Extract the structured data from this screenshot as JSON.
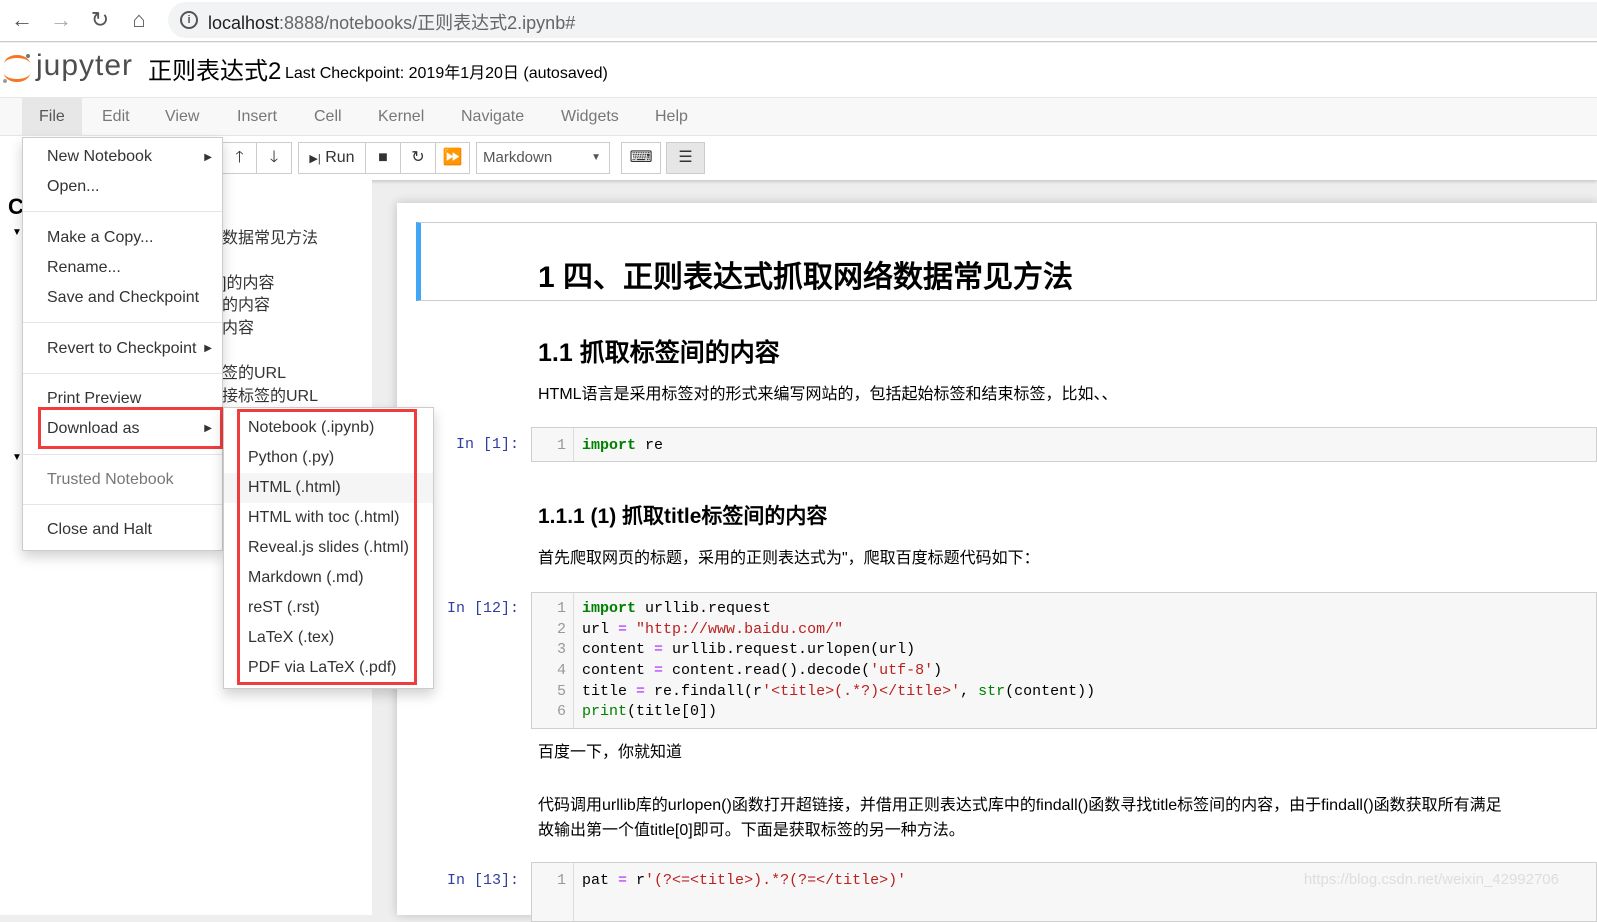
{
  "browser": {
    "url_host": "localhost",
    "url_rest": ":8888/notebooks/正则表达式2.ipynb#",
    "icons": [
      "back-icon",
      "forward-icon",
      "reload-icon",
      "home-icon",
      "info-icon"
    ]
  },
  "header": {
    "logo": "jupyter",
    "notebook_name": "正则表达式2",
    "checkpoint": "Last Checkpoint: 2019年1月20日   (autosaved)"
  },
  "menubar": [
    "File",
    "Edit",
    "View",
    "Insert",
    "Cell",
    "Kernel",
    "Navigate",
    "Widgets",
    "Help"
  ],
  "toolbar": {
    "run": "Run",
    "cell_type": "Markdown"
  },
  "toc": {
    "heading": "C",
    "items": [
      "数据常见方法",
      "]的内容",
      "的内容",
      "内容",
      "签的URL",
      "接标签的URL"
    ]
  },
  "file_menu": {
    "items": [
      "New Notebook",
      "Open...",
      "Make a Copy...",
      "Rename...",
      "Save and Checkpoint",
      "Revert to Checkpoint",
      "Print Preview",
      "Download as",
      "Trusted Notebook",
      "Close and Halt"
    ]
  },
  "download_menu": {
    "items": [
      "Notebook (.ipynb)",
      "Python (.py)",
      "HTML (.html)",
      "HTML with toc (.html)",
      "Reveal.js slides (.html)",
      "Markdown (.md)",
      "reST (.rst)",
      "LaTeX (.tex)",
      "PDF via LaTeX (.pdf)"
    ]
  },
  "notebook": {
    "h1": "1  四、正则表达式抓取网络数据常见方法",
    "h2": "1.1  抓取标签间的内容",
    "p1": "HTML语言是采用标签对的形式来编写网站的，包括起始标签和结束标签，比如、、",
    "cell1": {
      "prompt": "In  [1]:",
      "lines": [
        "import re"
      ]
    },
    "h3": "1.1.1  (1) 抓取title标签间的内容",
    "p2": "首先爬取网页的标题，采用的正则表达式为\"，爬取百度标题代码如下：",
    "cell12": {
      "prompt": "In  [12]:",
      "lines": [
        "import urllib.request",
        "url = \"http://www.baidu.com/\"",
        "content = urllib.request.urlopen(url)",
        "content = content.read().decode('utf-8')",
        "title = re.findall(r'<title>(.*?)</title>', str(content))",
        "print(title[0])"
      ],
      "output": "百度一下，你就知道"
    },
    "p3": "代码调用urllib库的urlopen()函数打开超链接，并借用正则表达式库中的findall()函数寻找title标签间的内容，由于findall()函数获取所有满足",
    "p4": "故输出第一个值title[0]即可。下面是获取标签的另一种方法。",
    "cell13": {
      "prompt": "In  [13]:",
      "lines": [
        "pat = r'(?<=<title>).*?(?=</title>)'"
      ]
    }
  },
  "watermark": "https://blog.csdn.net/weixin_42992706",
  "colors": {
    "highlight_box": "#f03c3c",
    "header_cell_border": "#42a5f5",
    "logo_orange": "#f37726"
  }
}
